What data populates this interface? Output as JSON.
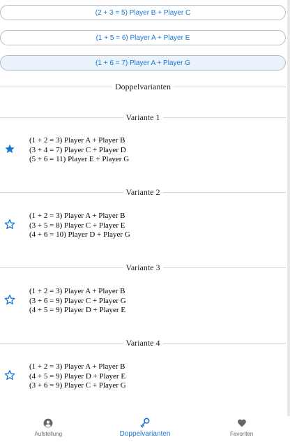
{
  "pairs": [
    {
      "label": "(2 + 3 = 5) Player B + Player C"
    },
    {
      "label": "(1 + 5 = 6) Player A + Player E"
    },
    {
      "label": "(1 + 6 = 7) Player A + Player G"
    }
  ],
  "section_title": "Doppelvarianten",
  "variants": [
    {
      "title": "Variante 1",
      "favorite": true,
      "lines": [
        "(1 + 2 = 3) Player A + Player B",
        "(3 + 4 = 7) Player C + Player D",
        "(5 + 6 = 11) Player E + Player G"
      ]
    },
    {
      "title": "Variante 2",
      "favorite": false,
      "lines": [
        "(1 + 2 = 3) Player A + Player B",
        "(3 + 5 = 8) Player C + Player E",
        "(4 + 6 = 10) Player D + Player G"
      ]
    },
    {
      "title": "Variante 3",
      "favorite": false,
      "lines": [
        "(1 + 2 = 3) Player A + Player B",
        "(3 + 6 = 9) Player C + Player G",
        "(4 + 5 = 9) Player D + Player E"
      ]
    },
    {
      "title": "Variante 4",
      "favorite": false,
      "lines": [
        "(1 + 2 = 3) Player A + Player B",
        "(4 + 5 = 9) Player D + Player E",
        "(3 + 6 = 9) Player C + Player G"
      ]
    }
  ],
  "nav": {
    "items": [
      {
        "label": "Aufstellung",
        "icon": "account-circle-icon",
        "active": false
      },
      {
        "label": "Doppelvarianten",
        "icon": "key-icon",
        "active": true
      },
      {
        "label": "Favoriten",
        "icon": "heart-icon",
        "active": false
      }
    ]
  },
  "colors": {
    "accent": "#1976d2",
    "highlight_bg": "#eaf3fc",
    "nav_inactive": "#666666"
  }
}
